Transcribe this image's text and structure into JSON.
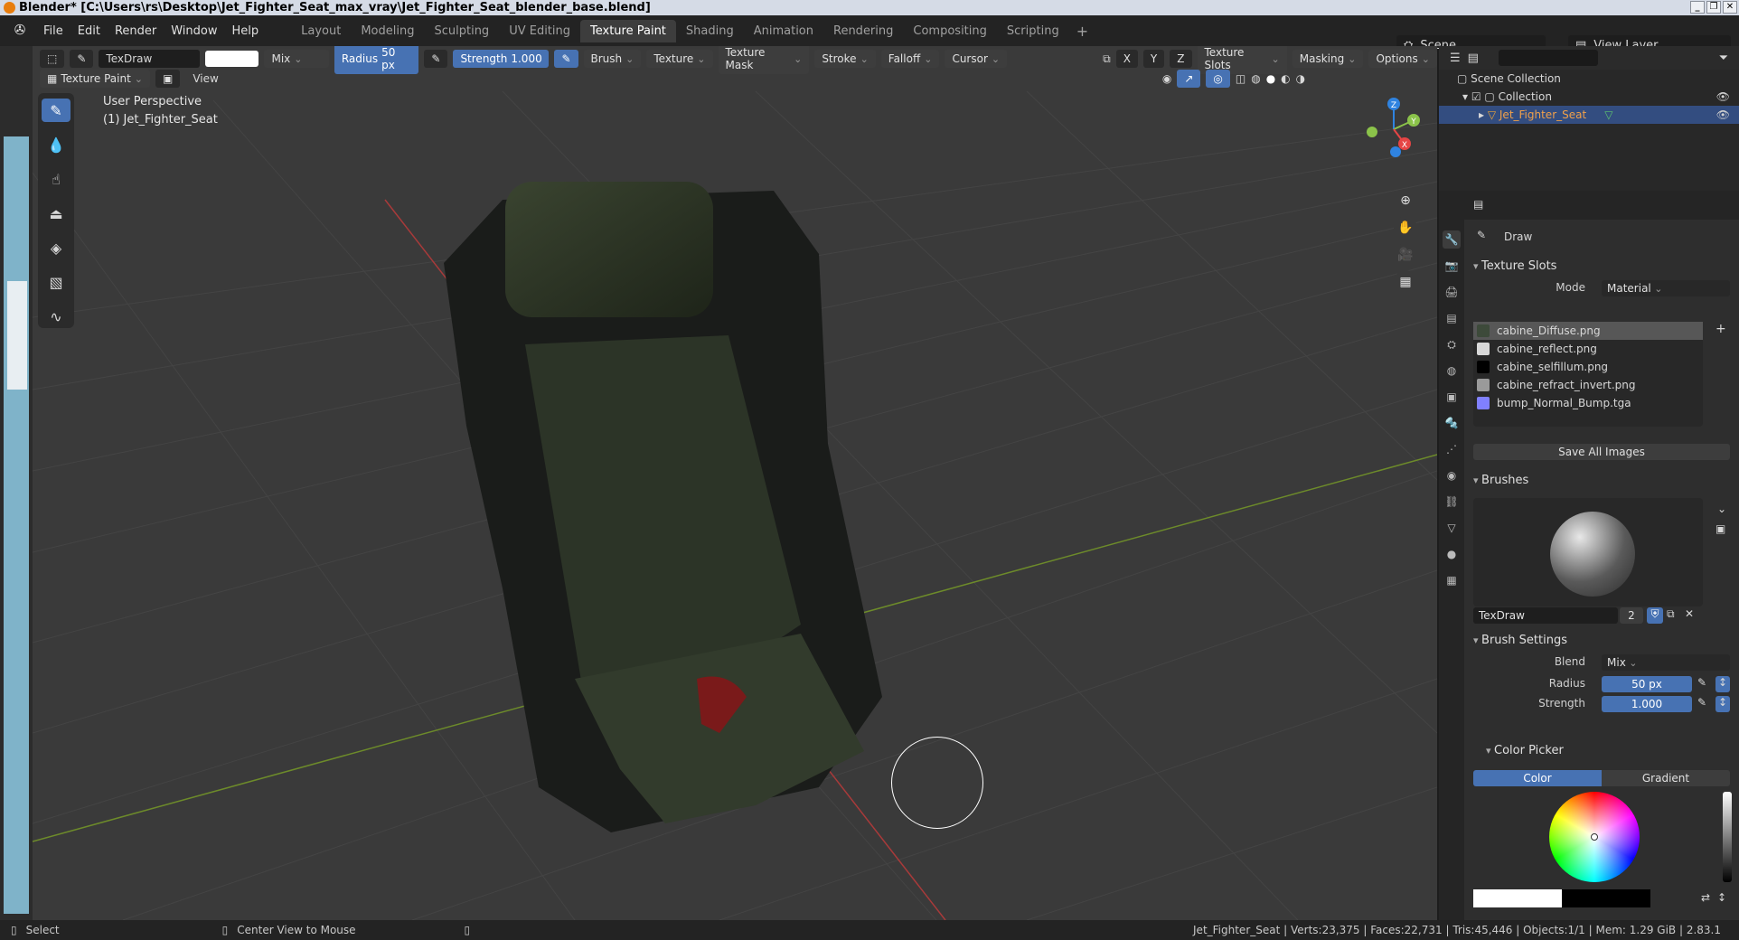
{
  "window": {
    "title": "Blender* [C:\\Users\\rs\\Desktop\\Jet_Fighter_Seat_max_vray\\Jet_Fighter_Seat_blender_base.blend]"
  },
  "menu": [
    "File",
    "Edit",
    "Render",
    "Window",
    "Help"
  ],
  "workspaces": [
    "Layout",
    "Modeling",
    "Sculpting",
    "UV Editing",
    "Texture Paint",
    "Shading",
    "Animation",
    "Rendering",
    "Compositing",
    "Scripting"
  ],
  "active_workspace": "Texture Paint",
  "scene": "Scene",
  "view_layer": "View Layer",
  "tool_header": {
    "brush_name": "TexDraw",
    "blend": "Mix",
    "radius_label": "Radius",
    "radius_value": "50 px",
    "strength_label": "Strength",
    "strength_value": "1.000",
    "menus": [
      "Brush",
      "Texture",
      "Texture Mask",
      "Stroke",
      "Falloff",
      "Cursor"
    ],
    "axes": [
      "X",
      "Y",
      "Z"
    ],
    "right_menus": [
      "Texture Slots",
      "Masking",
      "Options"
    ]
  },
  "viewport_header": {
    "mode": "Texture Paint",
    "view": "View"
  },
  "viewport_info": {
    "line1": "User Perspective",
    "line2": "(1) Jet_Fighter_Seat"
  },
  "gizmo_axes": {
    "x": "X",
    "y": "Y",
    "z": "Z"
  },
  "outliner": {
    "root": "Scene Collection",
    "collection": "Collection",
    "object": "Jet_Fighter_Seat"
  },
  "properties": {
    "tool": "Draw",
    "texture_slots": {
      "title": "Texture Slots",
      "mode_label": "Mode",
      "mode_value": "Material",
      "slots": [
        {
          "name": "cabine_Diffuse.png",
          "color": "#3d4a3a"
        },
        {
          "name": "cabine_reflect.png",
          "color": "#d8d8d8"
        },
        {
          "name": "cabine_selfillum.png",
          "color": "#000000"
        },
        {
          "name": "cabine_refract_invert.png",
          "color": "#9a9a9a"
        },
        {
          "name": "bump_Normal_Bump.tga",
          "color": "#8080ff"
        }
      ],
      "save_all": "Save All Images"
    },
    "brushes": {
      "title": "Brushes",
      "name": "TexDraw",
      "users": "2"
    },
    "brush_settings": {
      "title": "Brush Settings",
      "blend_label": "Blend",
      "blend_value": "Mix",
      "radius_label": "Radius",
      "radius_value": "50 px",
      "strength_label": "Strength",
      "strength_value": "1.000"
    },
    "color_picker": {
      "title": "Color Picker",
      "tab_color": "Color",
      "tab_gradient": "Gradient"
    }
  },
  "status": {
    "select": "Select",
    "center_view": "Center View to Mouse",
    "stats": "Jet_Fighter_Seat | Verts:23,375 | Faces:22,731 | Tris:45,446 | Objects:1/1 | Mem: 1.29 GiB | 2.83.1"
  }
}
